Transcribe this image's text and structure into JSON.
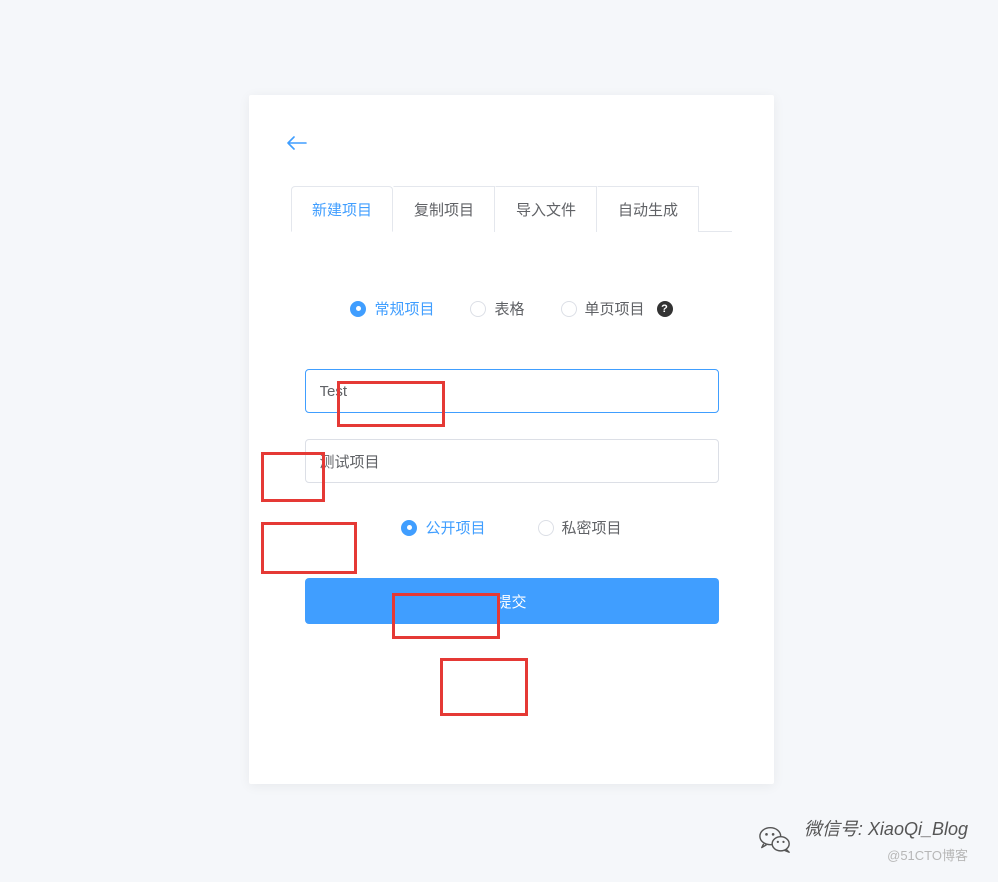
{
  "tabs": {
    "new_project": "新建项目",
    "copy_project": "复制项目",
    "import_file": "导入文件",
    "auto_generate": "自动生成"
  },
  "project_type": {
    "regular": "常规项目",
    "table": "表格",
    "single_page": "单页项目"
  },
  "inputs": {
    "name_value": "Test",
    "desc_value": "测试项目"
  },
  "visibility": {
    "public": "公开项目",
    "private": "私密项目"
  },
  "submit_label": "提交",
  "footer": {
    "wechat_label": "微信号: XiaoQi_Blog",
    "attribution": "@51CTO博客"
  }
}
